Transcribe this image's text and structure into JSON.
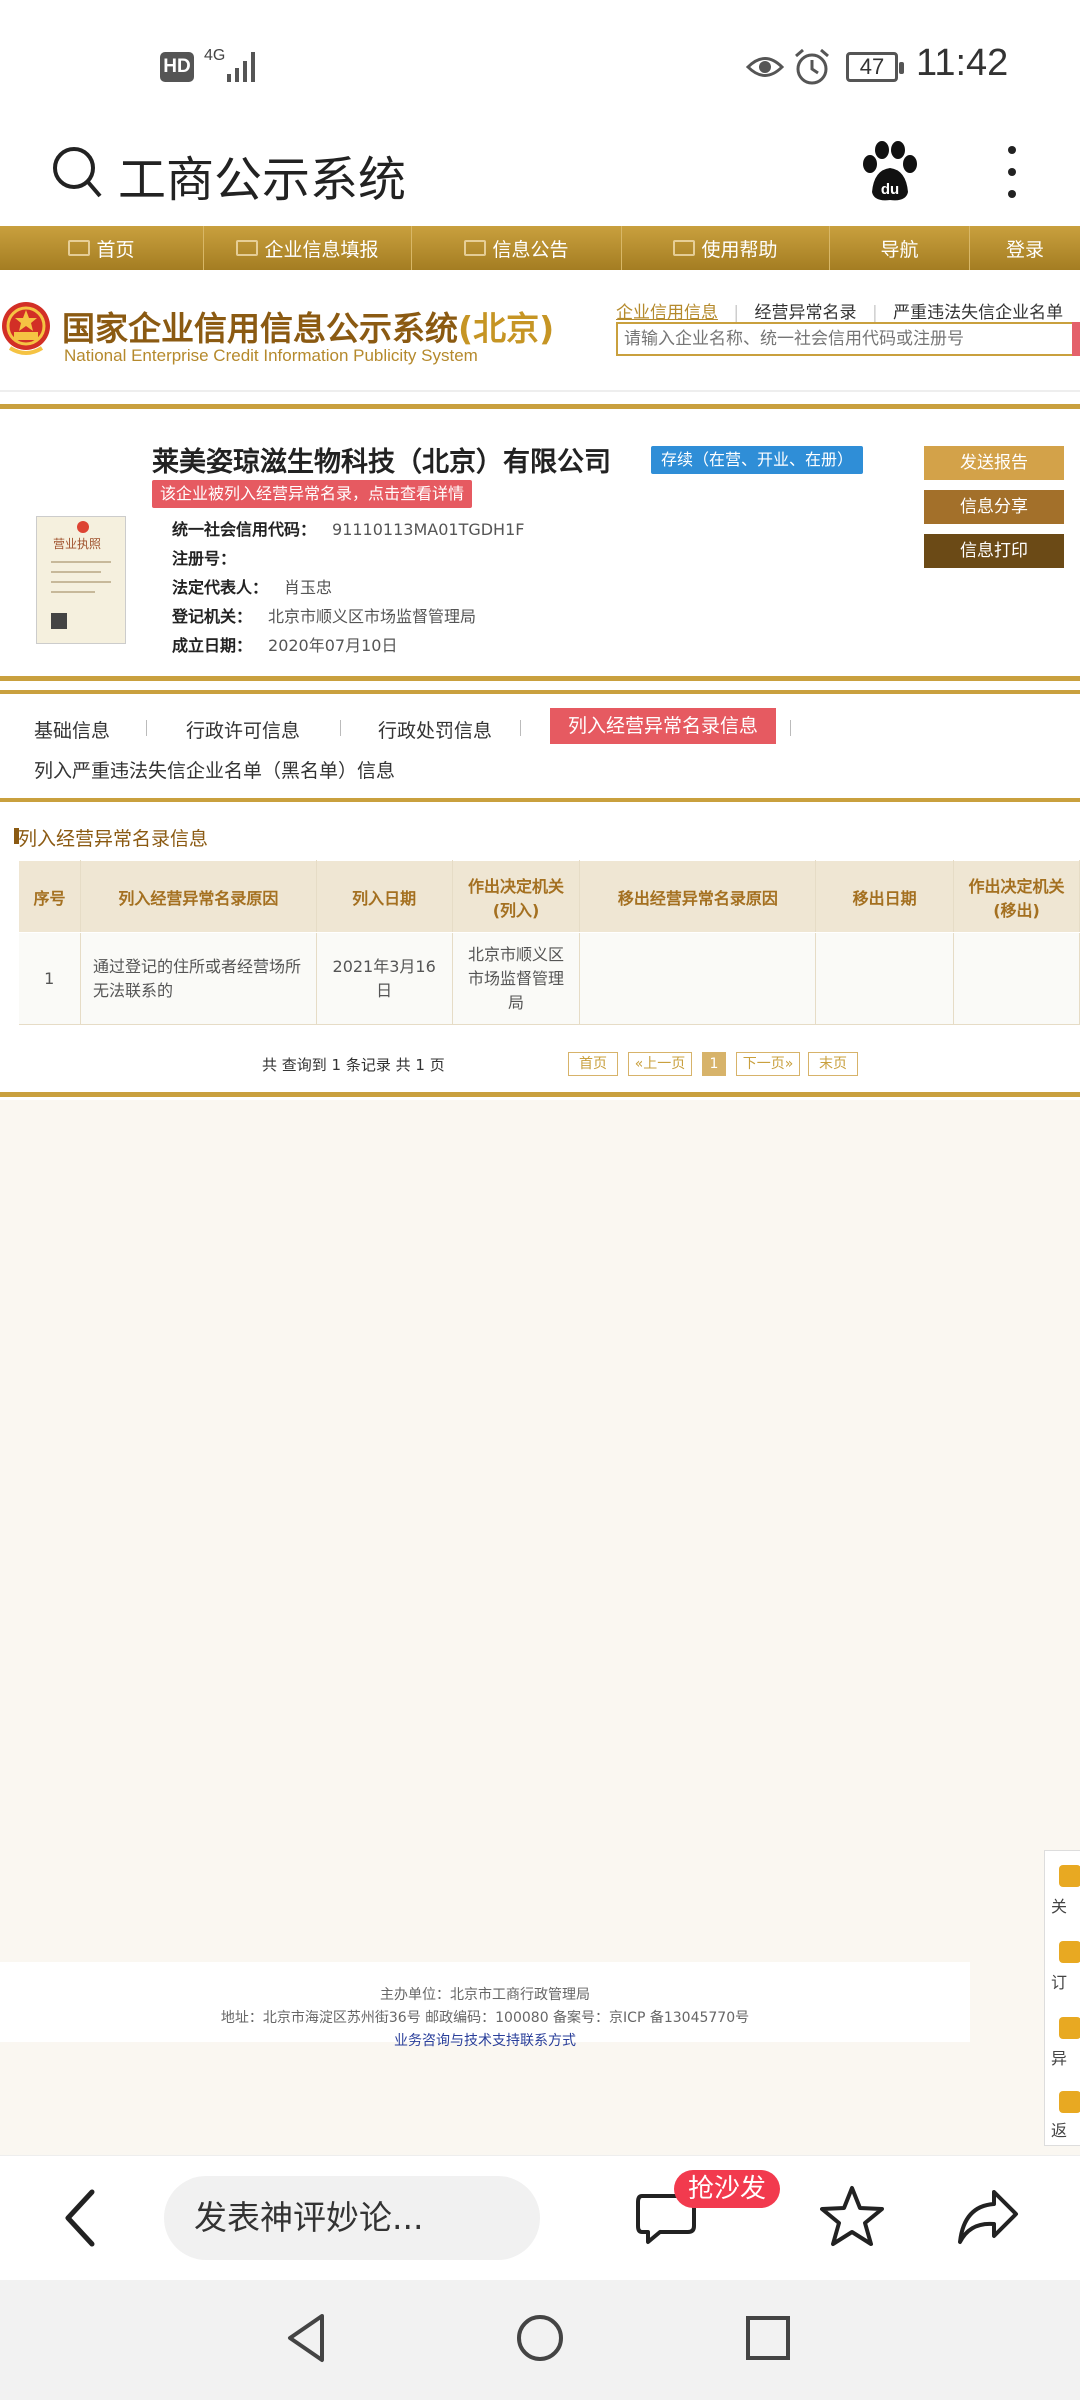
{
  "status_bar": {
    "hd": "HD",
    "network": "4G",
    "battery": "47",
    "time": "11:42"
  },
  "app_bar": {
    "title": "工商公示系统"
  },
  "gold_nav": {
    "items": [
      "首页",
      "企业信息填报",
      "信息公告",
      "使用帮助",
      "导航",
      "登录"
    ]
  },
  "site_header": {
    "logo_cn_main": "国家企业信用信息公示系统",
    "logo_cn_region": "(北京)",
    "logo_en": "National Enterprise Credit Information Publicity System",
    "links": [
      "企业信用信息",
      "经营异常名录",
      "严重违法失信企业名单"
    ],
    "search_placeholder": "请输入企业名称、统一社会信用代码或注册号"
  },
  "company": {
    "license_title": "营业执照",
    "name": "莱美姿琼滋生物科技（北京）有限公司",
    "status": "存续（在营、开业、在册）",
    "warning": "该企业被列入经营异常名录，点击查看详情",
    "fields": [
      {
        "label": "统一社会信用代码：",
        "value": "91110113MA01TGDH1F"
      },
      {
        "label": "注册号：",
        "value": ""
      },
      {
        "label": "法定代表人：",
        "value": "肖玉忠"
      },
      {
        "label": "登记机关：",
        "value": "北京市顺义区市场监督管理局"
      },
      {
        "label": "成立日期：",
        "value": "2020年07月10日"
      }
    ],
    "actions": [
      "发送报告",
      "信息分享",
      "信息打印"
    ]
  },
  "tabs": {
    "items": [
      "基础信息",
      "行政许可信息",
      "行政处罚信息",
      "列入经营异常名录信息",
      "列入严重违法失信企业名单（黑名单）信息"
    ],
    "active": "列入经营异常名录信息"
  },
  "section": {
    "title": "列入经营异常名录信息",
    "columns": [
      "序号",
      "列入经营异常名录原因",
      "列入日期",
      "作出决定机关(列入)",
      "移出经营异常名录原因",
      "移出日期",
      "作出决定机关(移出)"
    ],
    "rows": [
      [
        "1",
        "通过登记的住所或者经营场所无法联系的",
        "2021年3月16日",
        "北京市顺义区市场监督管理局",
        "",
        "",
        ""
      ]
    ],
    "pager_info": "共 查询到 1 条记录 共 1 页",
    "pager": [
      "首页",
      "«上一页",
      "1",
      "下一页»",
      "末页"
    ]
  },
  "footer": {
    "line1": "主办单位：北京市工商行政管理局",
    "line2": "地址：北京市海淀区苏州街36号 邮政编码：100080 备案号：京ICP 备13045770号",
    "link": "业务咨询与技术支持联系方式"
  },
  "float_bar": {
    "items": [
      "关",
      "订",
      "异",
      "返"
    ]
  },
  "bottom_bar": {
    "comment_placeholder": "发表神评妙论...",
    "badge": "抢沙发"
  }
}
